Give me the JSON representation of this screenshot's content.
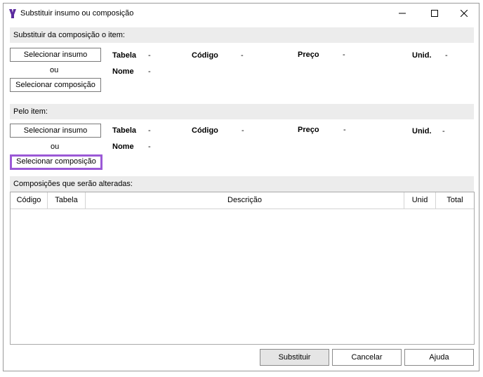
{
  "window": {
    "title": "Substituir insumo ou composição"
  },
  "section1": {
    "header": "Substituir da composição o item:",
    "btn_insumo": "Selecionar insumo",
    "or": "ou",
    "btn_composicao": "Selecionar composição",
    "labels": {
      "tabela": "Tabela",
      "codigo": "Código",
      "preco": "Preço",
      "unid": "Unid.",
      "nome": "Nome"
    },
    "values": {
      "tabela": "-",
      "codigo": "-",
      "preco": "-",
      "unid": "-",
      "nome": "-"
    }
  },
  "section2": {
    "header": "Pelo item:",
    "btn_insumo": "Selecionar insumo",
    "or": "ou",
    "btn_composicao": "Selecionar composição",
    "labels": {
      "tabela": "Tabela",
      "codigo": "Código",
      "preco": "Preço",
      "unid": "Unid.",
      "nome": "Nome"
    },
    "values": {
      "tabela": "-",
      "codigo": "-",
      "preco": "-",
      "unid": "-",
      "nome": "-"
    }
  },
  "section3": {
    "header": "Composições que serão alteradas:",
    "columns": [
      "Código",
      "Tabela",
      "Descrição",
      "Unid",
      "Total"
    ]
  },
  "footer": {
    "substituir": "Substituir",
    "cancelar": "Cancelar",
    "ajuda": "Ajuda"
  },
  "colors": {
    "accent": "#9b59d6",
    "header_bg": "#ececec"
  }
}
